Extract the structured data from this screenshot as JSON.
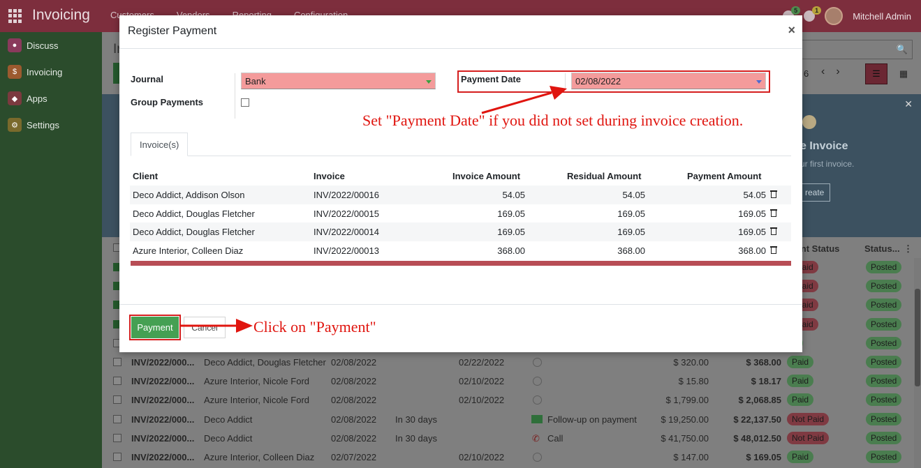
{
  "app": {
    "brand": "Invoicing",
    "menu": [
      "Customers",
      "Vendors",
      "Reporting",
      "Configuration"
    ],
    "badges": [
      "5",
      "1"
    ],
    "user": "Mitchell Admin"
  },
  "sidebar": {
    "items": [
      {
        "label": "Discuss",
        "icon": "chat-icon",
        "color": "#8a3a5c"
      },
      {
        "label": "Invoicing",
        "icon": "invoice-icon",
        "color": "#9c5a2f"
      },
      {
        "label": "Apps",
        "icon": "apps-icon",
        "color": "#7b3a3f"
      },
      {
        "label": "Settings",
        "icon": "gear-icon",
        "color": "#7a6a2c"
      }
    ]
  },
  "control_panel": {
    "title": "In",
    "pager": "6"
  },
  "helper": {
    "title": "e Invoice",
    "subtitle": "ur first invoice.",
    "button": "reate"
  },
  "background_list": {
    "headers": {
      "payment_status": "ment Status",
      "status": "Status..."
    },
    "rows": [
      {
        "checked": true,
        "number": "",
        "customer": "",
        "date": "",
        "terms": "",
        "due": "",
        "activity": "",
        "untaxed": "",
        "total": "",
        "payment": "t Paid",
        "payment_style": "notpaid",
        "status": "Posted"
      },
      {
        "checked": true,
        "number": "",
        "customer": "",
        "date": "",
        "terms": "",
        "due": "",
        "activity": "",
        "untaxed": "",
        "total": "",
        "payment": "t Paid",
        "payment_style": "notpaid",
        "status": "Posted"
      },
      {
        "checked": true,
        "number": "",
        "customer": "",
        "date": "",
        "terms": "",
        "due": "",
        "activity": "",
        "untaxed": "",
        "total": "",
        "payment": "t Paid",
        "payment_style": "notpaid",
        "status": "Posted"
      },
      {
        "checked": true,
        "number": "",
        "customer": "",
        "date": "",
        "terms": "",
        "due": "",
        "activity": "",
        "untaxed": "",
        "total": "",
        "payment": "t Paid",
        "payment_style": "notpaid",
        "status": "Posted"
      },
      {
        "checked": false,
        "number": "",
        "customer": "",
        "date": "",
        "terms": "",
        "due": "",
        "activity": "",
        "untaxed": "",
        "total": "",
        "payment": "id",
        "payment_style": "paid",
        "status": "Posted"
      },
      {
        "checked": false,
        "number": "INV/2022/000...",
        "customer": "Deco Addict, Douglas Fletcher",
        "date": "02/08/2022",
        "terms": "",
        "due": "02/22/2022",
        "activity": "",
        "untaxed": "$ 320.00",
        "total": "$ 368.00",
        "payment": "Paid",
        "payment_style": "paid",
        "status": "Posted"
      },
      {
        "checked": false,
        "number": "INV/2022/000...",
        "customer": "Azure Interior, Nicole Ford",
        "date": "02/08/2022",
        "terms": "",
        "due": "02/10/2022",
        "activity": "",
        "untaxed": "$ 15.80",
        "total": "$ 18.17",
        "payment": "Paid",
        "payment_style": "paid",
        "status": "Posted"
      },
      {
        "checked": false,
        "number": "INV/2022/000...",
        "customer": "Azure Interior, Nicole Ford",
        "date": "02/08/2022",
        "terms": "",
        "due": "02/10/2022",
        "activity": "",
        "untaxed": "$ 1,799.00",
        "total": "$ 2,068.85",
        "payment": "Paid",
        "payment_style": "paid",
        "status": "Posted"
      },
      {
        "checked": false,
        "number": "INV/2022/000...",
        "customer": "Deco Addict",
        "date": "02/08/2022",
        "terms": "In 30 days",
        "due": "",
        "activity": "Follow-up on payment",
        "untaxed": "$ 19,250.00",
        "total": "$ 22,137.50",
        "payment": "Not Paid",
        "payment_style": "notpaid",
        "status": "Posted"
      },
      {
        "checked": false,
        "number": "INV/2022/000...",
        "customer": "Deco Addict",
        "date": "02/08/2022",
        "terms": "In 30 days",
        "due": "",
        "activity": "Call",
        "untaxed": "$ 41,750.00",
        "total": "$ 48,012.50",
        "payment": "Not Paid",
        "payment_style": "notpaid",
        "status": "Posted"
      },
      {
        "checked": false,
        "number": "INV/2022/000...",
        "customer": "Azure Interior, Colleen Diaz",
        "date": "02/07/2022",
        "terms": "",
        "due": "02/10/2022",
        "activity": "",
        "untaxed": "$ 147.00",
        "total": "$ 169.05",
        "payment": "Paid",
        "payment_style": "paid",
        "status": "Posted"
      }
    ]
  },
  "modal": {
    "title": "Register Payment",
    "close": "×",
    "journal_label": "Journal",
    "journal_value": "Bank",
    "group_payments_label": "Group Payments",
    "payment_date_label": "Payment Date",
    "payment_date_value": "02/08/2022",
    "tab": "Invoice(s)",
    "columns": {
      "client": "Client",
      "invoice": "Invoice",
      "invoice_amount": "Invoice Amount",
      "residual_amount": "Residual Amount",
      "payment_amount": "Payment Amount"
    },
    "rows": [
      {
        "client": "Deco Addict, Addison Olson",
        "invoice": "INV/2022/00016",
        "invoice_amount": "54.05",
        "residual_amount": "54.05",
        "payment_amount": "54.05"
      },
      {
        "client": "Deco Addict, Douglas Fletcher",
        "invoice": "INV/2022/00015",
        "invoice_amount": "169.05",
        "residual_amount": "169.05",
        "payment_amount": "169.05"
      },
      {
        "client": "Deco Addict, Douglas Fletcher",
        "invoice": "INV/2022/00014",
        "invoice_amount": "169.05",
        "residual_amount": "169.05",
        "payment_amount": "169.05"
      },
      {
        "client": "Azure Interior, Colleen Diaz",
        "invoice": "INV/2022/00013",
        "invoice_amount": "368.00",
        "residual_amount": "368.00",
        "payment_amount": "368.00"
      }
    ],
    "payment_button": "Payment",
    "cancel_button": "Cancel"
  },
  "annotations": {
    "payment_date_note": "Set \"Payment Date\" if you did not set during invoice creation.",
    "payment_note": "Click on \"Payment\"",
    "color": "#e0150f"
  }
}
